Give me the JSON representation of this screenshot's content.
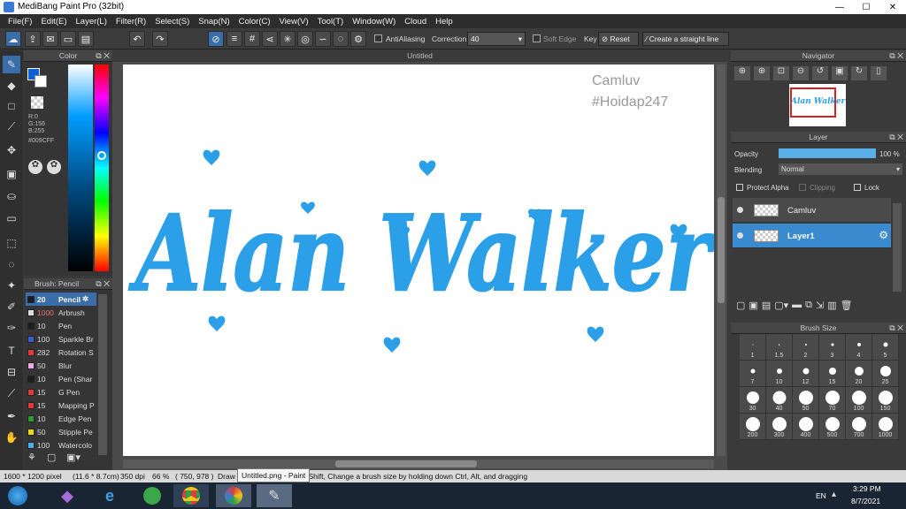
{
  "titlebar": {
    "title": "MediBang Paint Pro (32bit)"
  },
  "menu": [
    "File(F)",
    "Edit(E)",
    "Layer(L)",
    "Filter(R)",
    "Select(S)",
    "Snap(N)",
    "Color(C)",
    "View(V)",
    "Tool(T)",
    "Window(W)",
    "Cloud",
    "Help"
  ],
  "toolbar": {
    "antialiasing_label": "AntiAliasing",
    "correction_label": "Correction",
    "correction_value": "40",
    "soft_edge_label": "Soft Edge",
    "key_label": "Key",
    "reset_label": "Reset",
    "straight_line_label": "Create a straight line"
  },
  "color_panel": {
    "title": "Color",
    "r": "R:0",
    "g": "G:156",
    "b": "B:255",
    "hex": "#009CFF",
    "primary_color": "#0f5fd6",
    "hue_marker_color": "#009CFF"
  },
  "brush_panel": {
    "title": "Brush: Pencil",
    "items": [
      {
        "size": "20",
        "name": "Pencil",
        "color": "#1e1e1e",
        "selected": true
      },
      {
        "size": "1000",
        "name": "Arbrush",
        "color": "#dddddd"
      },
      {
        "size": "10",
        "name": "Pen",
        "color": "#1e1e1e"
      },
      {
        "size": "100",
        "name": "Sparkle Br",
        "color": "#3b5bd6"
      },
      {
        "size": "282",
        "name": "Rotation S",
        "color": "#e03a3a"
      },
      {
        "size": "50",
        "name": "Blur",
        "color": "#f0a8e8"
      },
      {
        "size": "10",
        "name": "Pen (Shar",
        "color": "#1e1e1e"
      },
      {
        "size": "15",
        "name": "G Pen",
        "color": "#e03a3a"
      },
      {
        "size": "15",
        "name": "Mapping P",
        "color": "#e03a3a"
      },
      {
        "size": "10",
        "name": "Edge Pen",
        "color": "#2aa02a"
      },
      {
        "size": "50",
        "name": "Stipple Pe",
        "color": "#e8d820"
      },
      {
        "size": "100",
        "name": "Watercolo",
        "color": "#4ab0f0"
      }
    ]
  },
  "document": {
    "tab": "Untitled",
    "watermark1": "Camluv",
    "watermark2": "#Hoidap247",
    "art_title": "Alan Walker"
  },
  "navigator": {
    "title": "Navigator",
    "thumb_text": "Alan Walker"
  },
  "layer_panel": {
    "title": "Layer",
    "opacity_label": "Opacity",
    "opacity_value": "100 %",
    "opacity_percent": 100,
    "blending_label": "Blending",
    "blending_value": "Normal",
    "protect_alpha": "Protect Alpha",
    "clipping": "Clipping",
    "lock": "Lock",
    "layers": [
      {
        "name": "Camluv",
        "selected": false
      },
      {
        "name": "Layer1",
        "selected": true
      }
    ]
  },
  "brush_size": {
    "title": "Brush Size",
    "sizes": [
      "1",
      "1.5",
      "2",
      "3",
      "4",
      "5",
      "7",
      "10",
      "12",
      "15",
      "20",
      "25",
      "30",
      "40",
      "50",
      "70",
      "100",
      "150",
      "200",
      "300",
      "400",
      "500",
      "700",
      "1000"
    ]
  },
  "status": {
    "dimensions": "1600 * 1200 pixel",
    "physical": "(11.6 * 8.7cm)",
    "dpi": "350 dpi",
    "zoom": "66 %",
    "coords": "( 750, 978 )",
    "hint_start": "Draw",
    "tooltip": "Untitled.png - Paint",
    "hint_end": "ng down Shift, Change a brush size by holding down Ctrl, Alt, and dragging"
  },
  "taskbar": {
    "lang": "EN",
    "time": "3:29 PM",
    "date": "8/7/2021"
  }
}
